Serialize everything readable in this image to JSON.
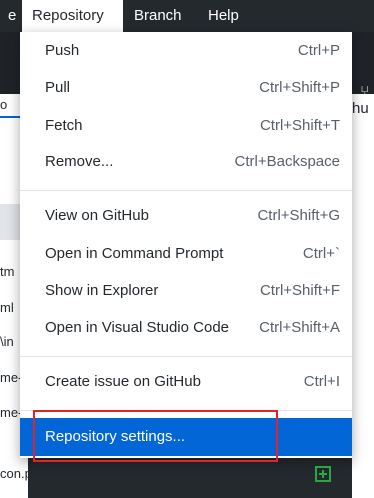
{
  "menubar": {
    "items": [
      {
        "label": "Repository"
      },
      {
        "label": "Branch"
      },
      {
        "label": "Help"
      }
    ]
  },
  "background": {
    "right_tab_label": "hu",
    "left_files": [
      "tm",
      "ml",
      "\\in",
      "me-",
      "me-",
      "con.png"
    ],
    "left_selected_marker": "o"
  },
  "menu": {
    "items": [
      {
        "label": "Push",
        "shortcut": "Ctrl+P"
      },
      {
        "label": "Pull",
        "shortcut": "Ctrl+Shift+P"
      },
      {
        "label": "Fetch",
        "shortcut": "Ctrl+Shift+T"
      },
      {
        "label": "Remove...",
        "shortcut": "Ctrl+Backspace"
      },
      {
        "label": "View on GitHub",
        "shortcut": "Ctrl+Shift+G"
      },
      {
        "label": "Open in Command Prompt",
        "shortcut": "Ctrl+`"
      },
      {
        "label": "Show in Explorer",
        "shortcut": "Ctrl+Shift+F"
      },
      {
        "label": "Open in Visual Studio Code",
        "shortcut": "Ctrl+Shift+A"
      },
      {
        "label": "Create issue on GitHub",
        "shortcut": "Ctrl+I"
      },
      {
        "label": "Repository settings...",
        "shortcut": ""
      }
    ],
    "selected": "Repository settings..."
  },
  "colors": {
    "menubar_bg": "#24292e",
    "selected_bg": "#0366d6",
    "highlight_border": "#e0242b",
    "plus_green": "#28a745"
  }
}
